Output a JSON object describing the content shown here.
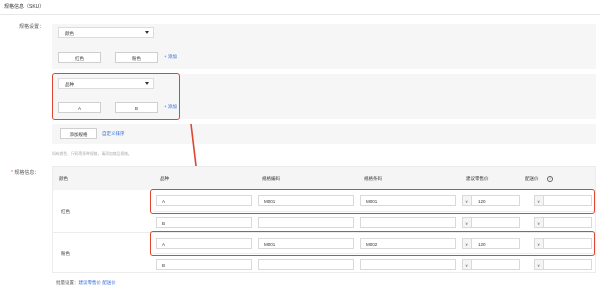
{
  "section": {
    "title": "规格信息（SKU）"
  },
  "spec_settings": {
    "label": "规格设置：",
    "groups": [
      {
        "name": "颜色",
        "values": [
          "红色",
          "粉色"
        ],
        "add_label": "+ 添加"
      },
      {
        "name": "品种",
        "values": [
          "A",
          "B"
        ],
        "add_label": "+ 添加"
      }
    ],
    "add_spec_button": "添加规格",
    "custom_sort_link": "自定义排序",
    "hint": "如有颜色、尺码等多种规格，请添加商品规格。"
  },
  "spec_info": {
    "required_mark": "*",
    "label": "规格信息：",
    "columns": [
      "颜色",
      "品种",
      "规格编码",
      "规格条码",
      "建议零售价",
      "配送价"
    ],
    "help_icon": "question-circle-icon",
    "currency": "¥",
    "rows": [
      {
        "color": "红色",
        "variant": "A",
        "code": "M001",
        "barcode": "M001",
        "price": "120",
        "delivery": ""
      },
      {
        "color": "",
        "variant": "B",
        "code": "",
        "barcode": "",
        "price": "",
        "delivery": ""
      },
      {
        "color": "粉色",
        "variant": "A",
        "code": "M001",
        "barcode": "M002",
        "price": "120",
        "delivery": ""
      },
      {
        "color": "",
        "variant": "B",
        "code": "",
        "barcode": "",
        "price": "",
        "delivery": ""
      }
    ],
    "bulk": {
      "label": "批量设置：",
      "links": [
        "建议零售价",
        "配送价"
      ]
    }
  },
  "colors": {
    "highlight": "#e0452f",
    "link": "#2f6bd8",
    "card_bg": "#f6f6f6"
  }
}
